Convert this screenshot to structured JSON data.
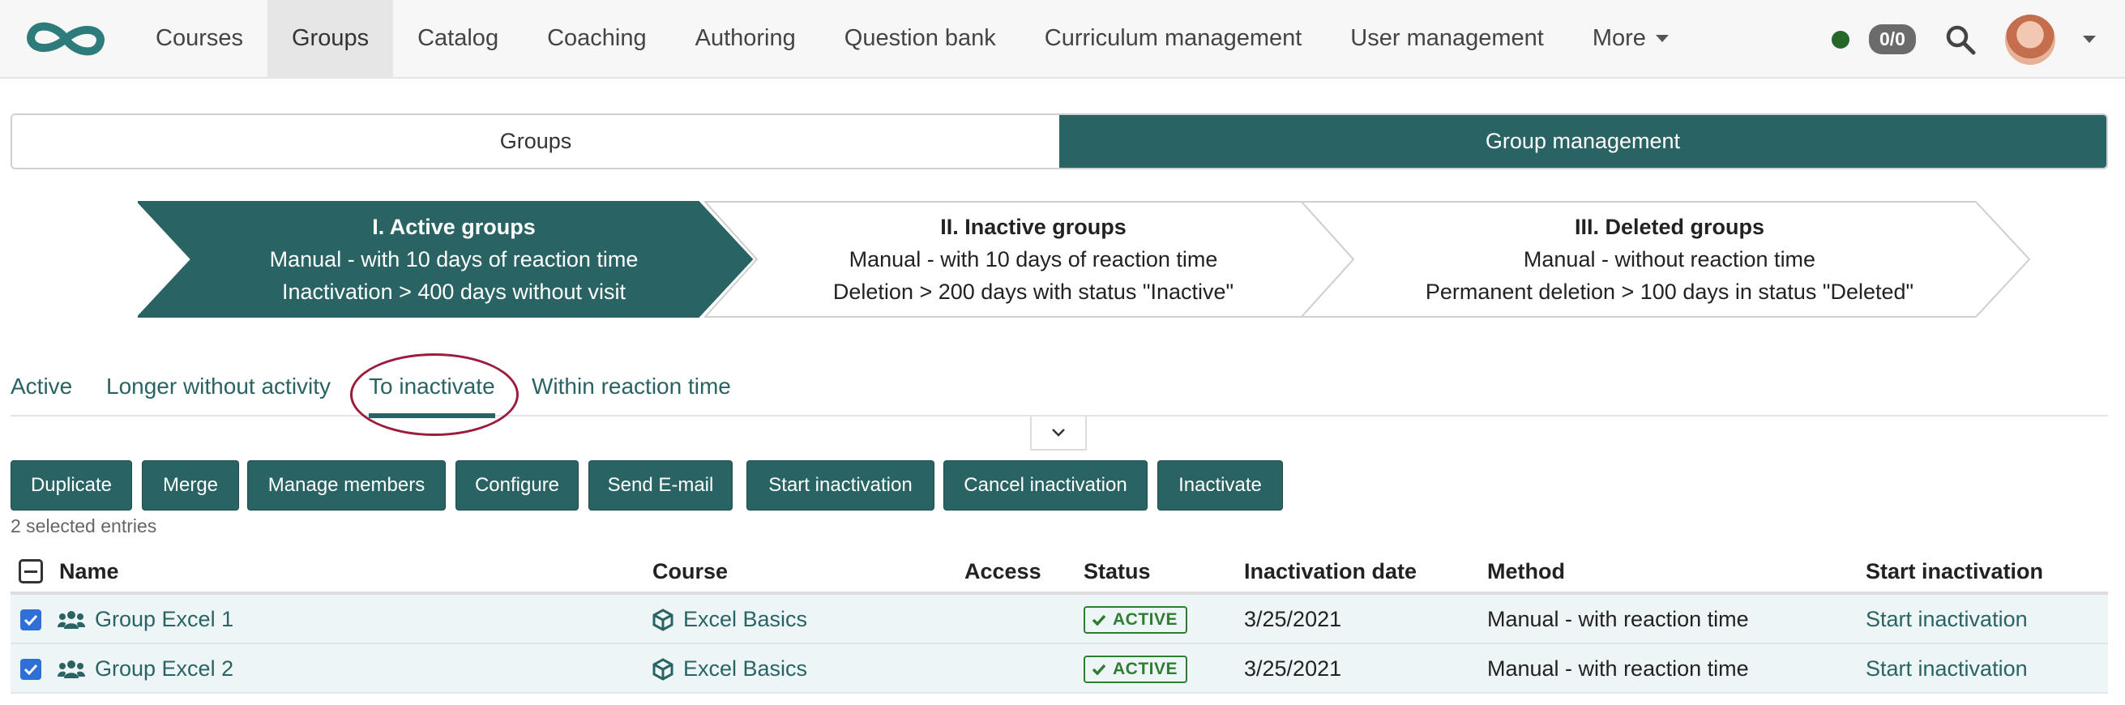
{
  "nav": {
    "items": [
      {
        "label": "Courses"
      },
      {
        "label": "Groups",
        "active": true
      },
      {
        "label": "Catalog"
      },
      {
        "label": "Coaching"
      },
      {
        "label": "Authoring"
      },
      {
        "label": "Question bank"
      },
      {
        "label": "Curriculum management"
      },
      {
        "label": "User management"
      },
      {
        "label": "More"
      }
    ],
    "counter": "0/0",
    "status_color": "#27682a"
  },
  "segmented": {
    "left": "Groups",
    "right": "Group management"
  },
  "steps": [
    {
      "title": "I. Active groups",
      "line1": "Manual - with 10 days of reaction time",
      "line2": "Inactivation > 400 days without visit"
    },
    {
      "title": "II. Inactive groups",
      "line1": "Manual - with 10 days of reaction time",
      "line2": "Deletion > 200 days with status \"Inactive\""
    },
    {
      "title": "III. Deleted groups",
      "line1": "Manual - without reaction time",
      "line2": "Permanent deletion > 100 days in status \"Deleted\""
    }
  ],
  "filter_tabs": [
    {
      "label": "Active"
    },
    {
      "label": "Longer without activity"
    },
    {
      "label": "To inactivate",
      "active": true
    },
    {
      "label": "Within reaction time"
    }
  ],
  "actions": {
    "duplicate": "Duplicate",
    "merge": "Merge",
    "manage_members": "Manage members",
    "configure": "Configure",
    "send_email": "Send E-mail",
    "start_inactivation": "Start inactivation",
    "cancel_inactivation": "Cancel inactivation",
    "inactivate": "Inactivate"
  },
  "selected_info": "2 selected entries",
  "table": {
    "headers": {
      "name": "Name",
      "course": "Course",
      "access": "Access",
      "status": "Status",
      "inactivation_date": "Inactivation date",
      "method": "Method",
      "start_inactivation": "Start inactivation"
    },
    "rows": [
      {
        "name": "Group Excel 1",
        "course": "Excel Basics",
        "status": "ACTIVE",
        "inactivation_date": "3/25/2021",
        "method": "Manual - with reaction time",
        "action": "Start inactivation"
      },
      {
        "name": "Group Excel 2",
        "course": "Excel Basics",
        "status": "ACTIVE",
        "inactivation_date": "3/25/2021",
        "method": "Manual - with reaction time",
        "action": "Start inactivation"
      }
    ]
  },
  "colors": {
    "primary": "#2a6363",
    "active_badge": "#2f7d32",
    "highlight": "#9b1c3c"
  }
}
